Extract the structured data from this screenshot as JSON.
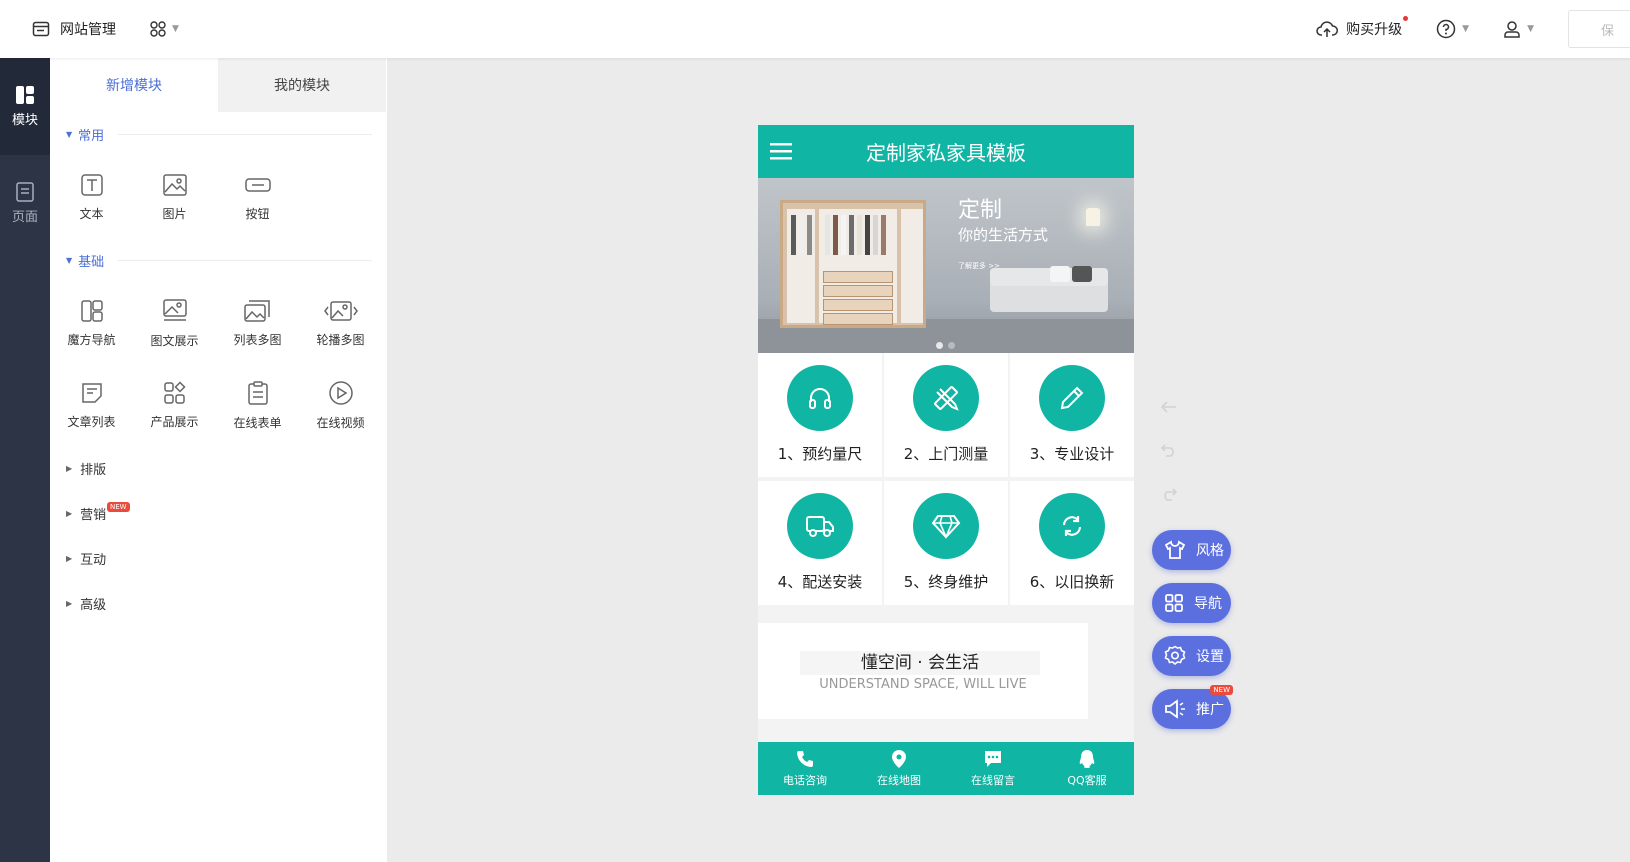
{
  "topbar": {
    "site_title": "网站管理",
    "upgrade_label": "购买升级",
    "save_label": "保"
  },
  "rail": {
    "items": [
      {
        "label": "模块",
        "icon": "module-icon",
        "active": true
      },
      {
        "label": "页面",
        "icon": "page-icon",
        "active": false
      }
    ]
  },
  "panel": {
    "tabs": [
      {
        "label": "新增模块",
        "active": true
      },
      {
        "label": "我的模块",
        "active": false
      }
    ],
    "sections": [
      {
        "title": "常用",
        "items": [
          {
            "label": "文本",
            "icon": "text-icon"
          },
          {
            "label": "图片",
            "icon": "image-icon"
          },
          {
            "label": "按钮",
            "icon": "button-icon"
          }
        ]
      },
      {
        "title": "基础",
        "items": [
          {
            "label": "魔方导航",
            "icon": "cube-nav-icon"
          },
          {
            "label": "图文展示",
            "icon": "image-text-icon"
          },
          {
            "label": "列表多图",
            "icon": "list-images-icon"
          },
          {
            "label": "轮播多图",
            "icon": "carousel-icon"
          },
          {
            "label": "文章列表",
            "icon": "article-list-icon"
          },
          {
            "label": "产品展示",
            "icon": "product-icon"
          },
          {
            "label": "在线表单",
            "icon": "form-icon"
          },
          {
            "label": "在线视频",
            "icon": "video-icon"
          }
        ]
      }
    ],
    "collapsed": [
      {
        "label": "排版",
        "badge": ""
      },
      {
        "label": "营销",
        "badge": "NEW"
      },
      {
        "label": "互动",
        "badge": ""
      },
      {
        "label": "高级",
        "badge": ""
      }
    ]
  },
  "phone": {
    "title": "定制家私家具模板",
    "banner": {
      "title": "定制",
      "subtitle": "你的生活方式",
      "more": "了解更多 >>"
    },
    "services": [
      {
        "label": "1、预约量尺",
        "icon": "headphones-icon"
      },
      {
        "label": "2、上门测量",
        "icon": "ruler-pencil-icon"
      },
      {
        "label": "3、专业设计",
        "icon": "pen-icon"
      },
      {
        "label": "4、配送安装",
        "icon": "truck-icon"
      },
      {
        "label": "5、终身维护",
        "icon": "diamond-icon"
      },
      {
        "label": "6、以旧换新",
        "icon": "refresh-icon"
      }
    ],
    "slogan_cn": "懂空间 · 会生活",
    "slogan_en": "UNDERSTAND SPACE, WILL LIVE",
    "footer": [
      {
        "label": "电话咨询",
        "icon": "phone-icon"
      },
      {
        "label": "在线地图",
        "icon": "map-pin-icon"
      },
      {
        "label": "在线留言",
        "icon": "message-icon"
      },
      {
        "label": "QQ客服",
        "icon": "qq-icon"
      }
    ],
    "accent_color": "#11b5a4"
  },
  "side_tools": [
    {
      "label": "风格",
      "icon": "tshirt-icon",
      "badge": ""
    },
    {
      "label": "导航",
      "icon": "grid-icon",
      "badge": ""
    },
    {
      "label": "设置",
      "icon": "gear-icon",
      "badge": ""
    },
    {
      "label": "推广",
      "icon": "megaphone-icon",
      "badge": "NEW"
    }
  ],
  "colors": {
    "brand_blue": "#4a6fd8",
    "pill_blue": "#5b6fdf",
    "rail_dark": "#2c3446"
  }
}
